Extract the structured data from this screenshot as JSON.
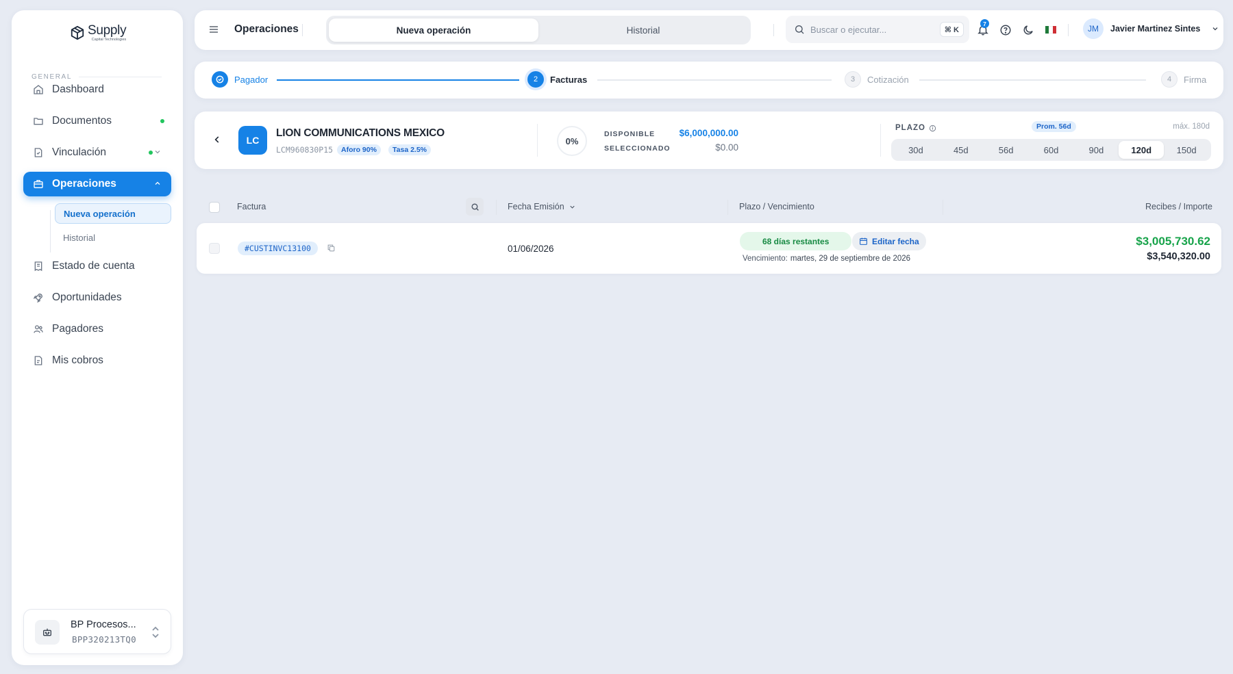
{
  "app": {
    "logo_name": "Supply",
    "logo_sub": "Capital Technologies"
  },
  "sidebar": {
    "section_label": "GENERAL",
    "items": [
      {
        "label": "Dashboard",
        "icon": "home-icon"
      },
      {
        "label": "Documentos",
        "icon": "folder-icon",
        "status_dot": "#22c55e"
      },
      {
        "label": "Vinculación",
        "icon": "file-check-icon",
        "status_dot": "#22c55e"
      },
      {
        "label": "Operaciones",
        "icon": "briefcase-icon",
        "active": true
      },
      {
        "label": "Estado de cuenta",
        "icon": "receipt-icon"
      },
      {
        "label": "Oportunidades",
        "icon": "rocket-icon"
      },
      {
        "label": "Pagadores",
        "icon": "users-icon"
      },
      {
        "label": "Mis cobros",
        "icon": "document-icon"
      }
    ],
    "subitems": [
      {
        "label": "Nueva operación",
        "active": true
      },
      {
        "label": "Historial"
      }
    ],
    "account": {
      "name": "BP Procesos...",
      "id": "BPP320213TQ0"
    }
  },
  "topbar": {
    "title": "Operaciones",
    "tabs": [
      {
        "label": "Nueva operación",
        "active": true
      },
      {
        "label": "Historial"
      }
    ],
    "search_placeholder": "Buscar o ejecutar...",
    "search_shortcut": "⌘ K",
    "notification_count": "7",
    "user_initials": "JM",
    "user_name": "Javier Martinez Sintes"
  },
  "stepper": {
    "steps": [
      {
        "label": "Pagador",
        "num": "✓",
        "state": "done"
      },
      {
        "label": "Facturas",
        "num": "2",
        "state": "current"
      },
      {
        "label": "Cotización",
        "num": "3",
        "state": "pending"
      },
      {
        "label": "Firma",
        "num": "4",
        "state": "pending"
      }
    ]
  },
  "payer": {
    "initials": "LC",
    "name": "LION COMMUNICATIONS MEXICO",
    "rfc": "LCM960830P15",
    "aforo": "Aforo 90%",
    "tasa": "Tasa 2.5%",
    "percent": "0%",
    "disponible_label": "DISPONIBLE",
    "disponible_value": "$6,000,000.00",
    "seleccionado_label": "SELECCIONADO",
    "seleccionado_value": "$0.00",
    "plazo_label": "PLAZO",
    "prom_label": "Prom. 56d",
    "max_label": "máx. 180d",
    "plazo_options": [
      "30d",
      "45d",
      "56d",
      "60d",
      "90d",
      "120d",
      "150d"
    ],
    "plazo_selected": "120d"
  },
  "table": {
    "headers": {
      "factura": "Factura",
      "fecha": "Fecha Emisión",
      "plazo": "Plazo / Vencimiento",
      "importe": "Recibes / Importe"
    },
    "rows": [
      {
        "invoice": "#CUSTINVC13100",
        "date": "01/06/2026",
        "days_left": "68 días restantes",
        "edit_label": "Editar fecha",
        "venc_label": "Vencimiento:",
        "venc_date": "martes, 29 de septiembre de 2026",
        "recibes": "$3,005,730.62",
        "importe": "$3,540,320.00"
      }
    ]
  },
  "colors": {
    "accent": "#1682e6",
    "success": "#17a34a",
    "background": "#e7ebf3"
  }
}
